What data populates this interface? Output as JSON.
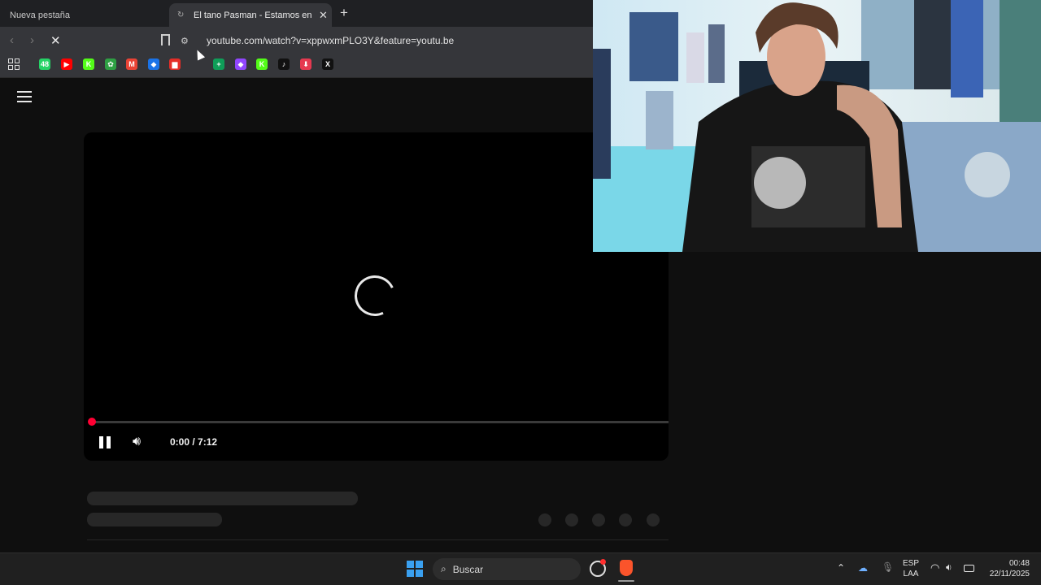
{
  "browser": {
    "tabs": [
      {
        "title": "Nueva pestaña"
      },
      {
        "title": "El tano Pasman - Estamos en la B"
      }
    ],
    "url": "youtube.com/watch?v=xppwxmPLO3Y&feature=youtu.be",
    "bookmarks": [
      {
        "icon": "whatsapp-icon",
        "color": "#25d366",
        "glyph": "48"
      },
      {
        "icon": "youtube-icon",
        "color": "#ff0000",
        "glyph": "▶"
      },
      {
        "icon": "kick-icon",
        "color": "#53fc18",
        "glyph": "K"
      },
      {
        "icon": "app-icon",
        "color": "#2ea043",
        "glyph": "✿"
      },
      {
        "icon": "gmail-icon",
        "color": "#ea4335",
        "glyph": "M"
      },
      {
        "icon": "app-icon-blue",
        "color": "#1a73e8",
        "glyph": "◆"
      },
      {
        "icon": "analytics-icon",
        "color": "#e52d27",
        "glyph": "▆"
      },
      {
        "icon": "sheets-icon",
        "color": "#0f9d58",
        "glyph": "+"
      },
      {
        "icon": "app-icon-purple",
        "color": "#9146ff",
        "glyph": "◆"
      },
      {
        "icon": "kick-icon",
        "color": "#53fc18",
        "glyph": "K"
      },
      {
        "icon": "tiktok-icon",
        "color": "#111111",
        "glyph": "♪"
      },
      {
        "icon": "download-icon",
        "color": "#e63950",
        "glyph": "⬇"
      },
      {
        "icon": "x-icon",
        "color": "#111111",
        "glyph": "X"
      }
    ]
  },
  "player": {
    "time": "0:00 / 7:12",
    "progress": 0,
    "accent": "#ff0033"
  },
  "taskbar": {
    "search_placeholder": "Buscar",
    "language": "ESP",
    "layout": "LAA",
    "time": "00:48",
    "date": "22/11/2025"
  }
}
